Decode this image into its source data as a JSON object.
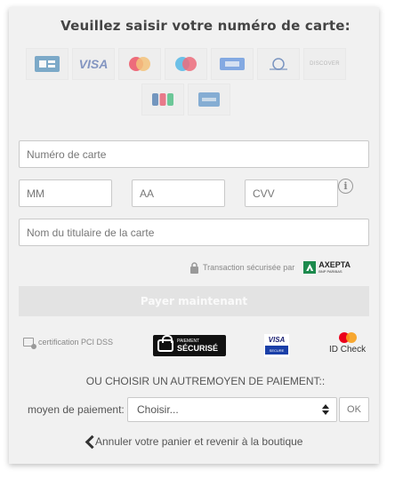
{
  "title": "Veuillez saisir votre numéro de carte:",
  "card_brands": {
    "row1": [
      "cb-card",
      "visa-card",
      "mastercard-card",
      "maestro-card",
      "amex-blue-card",
      "diners-card",
      "discover-card"
    ],
    "row2": [
      "jcb-card",
      "amex-card"
    ],
    "visa_text": "VISA",
    "discover_text": "DISCOVER"
  },
  "fields": {
    "card_number_placeholder": "Numéro de carte",
    "month_placeholder": "MM",
    "year_placeholder": "AA",
    "cvv_placeholder": "CVV",
    "holder_placeholder": "Nom du titulaire de la carte"
  },
  "secure_note": {
    "text": "Transaction sécurisée par",
    "provider": "AXEPTA",
    "provider_sub": "BNP PARIBAS"
  },
  "pay_button": "Payer maintenant",
  "badges": {
    "pci": "certification PCI DSS",
    "secure_payment_small": "PAIEMENT",
    "secure_payment_big": "SÉCURISÉ",
    "visa_secure_top": "VISA",
    "visa_secure_bottom": "SECURE",
    "idcheck": "ID Check"
  },
  "other_payment": {
    "title": "OU CHOISIR UN AUTREMOYEN DE PAIEMENT::",
    "label": "moyen de paiement:",
    "selected": "Choisir...",
    "ok_label": "OK"
  },
  "cancel_link": "Annuler votre panier et revenir à la boutique"
}
